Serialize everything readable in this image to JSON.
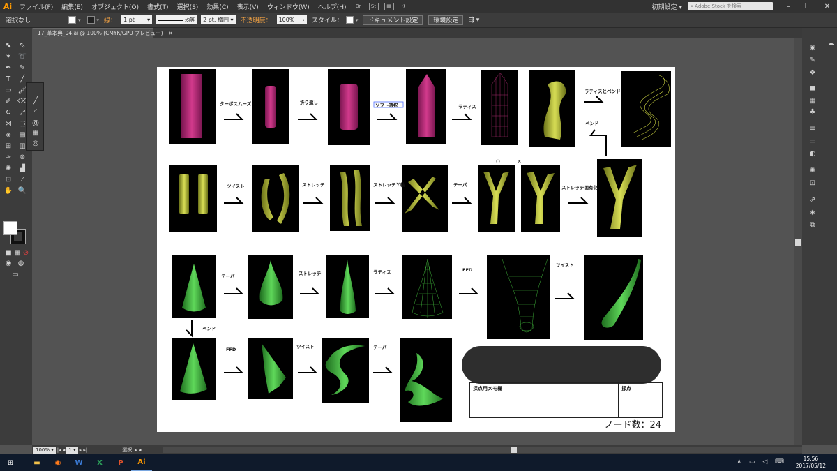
{
  "app": {
    "logo": "Ai",
    "menu": [
      "ファイル(F)",
      "編集(E)",
      "オブジェクト(O)",
      "書式(T)",
      "選択(S)",
      "効果(C)",
      "表示(V)",
      "ウィンドウ(W)",
      "ヘルプ(H)"
    ],
    "menu_icons": [
      "Br",
      "St"
    ],
    "workspace": "初期設定",
    "stock_placeholder": "Adobe Stock を検索"
  },
  "control_bar": {
    "selection": "選択なし",
    "stroke_label": "線：",
    "stroke_weight": "1 pt",
    "stroke_profile": "均等",
    "brush": "2 pt. 楕円",
    "opacity_label": "不透明度：",
    "opacity_value": "100%",
    "style_label": "スタイル：",
    "doc_settings": "ドキュメント設定",
    "preferences": "環境設定"
  },
  "document_tab": {
    "title": "17_革本典_04.ai @ 100% (CMYK/GPU プレビュー)",
    "close": "×"
  },
  "artboard": {
    "labels": {
      "turbosmooth": "ターボスムーズ",
      "fold": "折り返し",
      "soft_select": "ソフト選択",
      "lattice1": "ラティス",
      "lattice_bend": "ラティスとベンド",
      "bend1": "ベンド",
      "twist1": "ツイスト",
      "stretch1": "ストレッチ",
      "stretch_y": "ストレッチＹ軸",
      "taper1": "テーパ",
      "circle_mark": "○",
      "x_mark": "×",
      "stretch_fixed": "ストレッチ固有化",
      "taper2": "テーパ",
      "stretch2": "ストレッチ",
      "lattice2": "ラティス",
      "ffd1": "FFD",
      "twist2": "ツイスト",
      "bend2": "ベンド",
      "ffd2": "FFD",
      "twist3": "ツイスト",
      "taper3": "テーパ"
    },
    "memo_label": "採点用メモ欄",
    "score_label": "採点",
    "node_count": "ノード数：24"
  },
  "status_bar": {
    "zoom": "100%",
    "page": "1",
    "tool": "選択"
  },
  "taskbar": {
    "time": "15:56",
    "date": "2017/05/12"
  },
  "colors": {
    "magenta": "#c2307e",
    "olive": "#b9c235",
    "green": "#3fb43a"
  }
}
